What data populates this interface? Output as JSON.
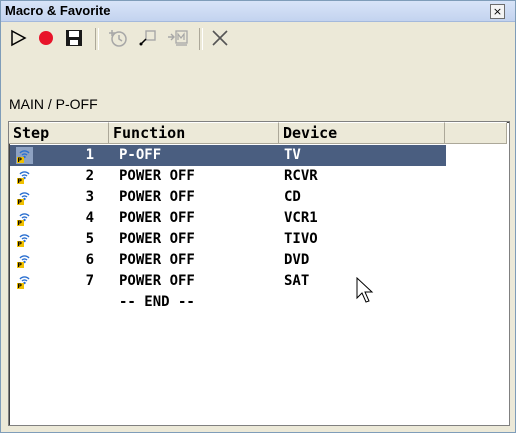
{
  "window": {
    "title": "Macro & Favorite",
    "close_label": "×"
  },
  "toolbar": {
    "buttons": [
      {
        "name": "play-icon"
      },
      {
        "name": "record-icon"
      },
      {
        "name": "save-icon"
      },
      {
        "name": "add-step-icon"
      },
      {
        "name": "insert-icon"
      },
      {
        "name": "macro-insert-icon"
      },
      {
        "name": "delete-icon"
      }
    ]
  },
  "path": "MAIN / P-OFF",
  "columns": [
    "Step",
    "Function",
    "Device"
  ],
  "rows": [
    {
      "step": "1",
      "function": "P-OFF",
      "device": "TV",
      "selected": true
    },
    {
      "step": "2",
      "function": "POWER OFF",
      "device": "RCVR"
    },
    {
      "step": "3",
      "function": "POWER OFF",
      "device": "CD"
    },
    {
      "step": "4",
      "function": "POWER OFF",
      "device": "VCR1"
    },
    {
      "step": "5",
      "function": "POWER OFF",
      "device": "TIVO"
    },
    {
      "step": "6",
      "function": "POWER OFF",
      "device": "DVD"
    },
    {
      "step": "7",
      "function": "POWER OFF",
      "device": "SAT"
    }
  ],
  "end_marker": "-- END --",
  "colors": {
    "selection": "#4a5e80",
    "record": "#e8142a"
  }
}
